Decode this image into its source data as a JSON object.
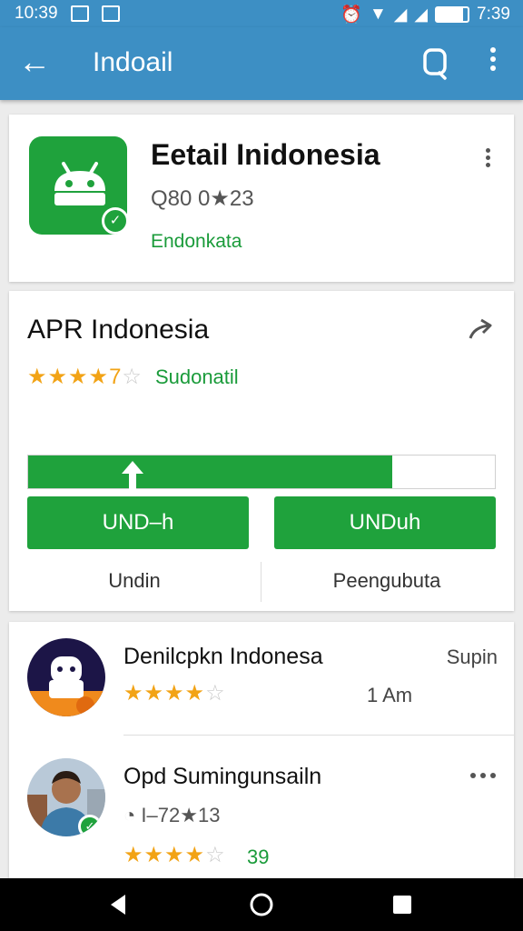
{
  "status_bar": {
    "time_left": "10:39",
    "time_right": "7:39"
  },
  "app_bar": {
    "title": "Indoail"
  },
  "app_card": {
    "name": "Eetail Inidonesia",
    "meta": "Q80 0★23",
    "developer": "Endonkata"
  },
  "detail_card": {
    "title": "APR Indonesia",
    "stars": 4,
    "stars_label": "7",
    "rating_text": "Sudonatil",
    "progress": 0.78,
    "button_left": "UND–h",
    "button_right": "UNDuh",
    "tab_left": "Undin",
    "tab_right": "Peengubuta"
  },
  "reviews": [
    {
      "name": "Denilcpkn Indonesa",
      "right_text": "Supin",
      "stars": 4,
      "time": "1 Am"
    },
    {
      "name": "Opd Sumingunsailn",
      "meta": "I–72★13",
      "stars": 4,
      "count": "39"
    }
  ],
  "colors": {
    "primary": "#3d8fc4",
    "accent_green": "#1fa23c",
    "star": "#f2a316"
  }
}
